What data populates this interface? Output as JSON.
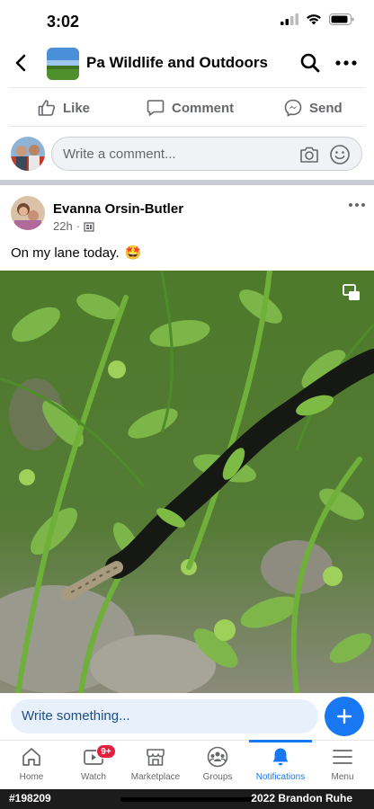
{
  "status_bar": {
    "time": "3:02"
  },
  "header": {
    "title": "Pa Wildlife and Outdoors"
  },
  "reactions": {
    "like": "Like",
    "comment": "Comment",
    "send": "Send"
  },
  "comment_box": {
    "placeholder": "Write a comment..."
  },
  "post": {
    "author": "Evanna Orsin-Butler",
    "time": "22h",
    "text": "On my lane today.",
    "emoji": "🤩"
  },
  "composer": {
    "placeholder": "Write something..."
  },
  "tabs": [
    {
      "label": "Home"
    },
    {
      "label": "Watch",
      "badge": "9+"
    },
    {
      "label": "Marketplace"
    },
    {
      "label": "Groups"
    },
    {
      "label": "Notifications",
      "active": true
    },
    {
      "label": "Menu"
    }
  ],
  "footer": {
    "left": "#198209",
    "right": "2022 Brandon Ruhe"
  },
  "colors": {
    "accent": "#1877f2",
    "badge": "#e41e3f"
  }
}
